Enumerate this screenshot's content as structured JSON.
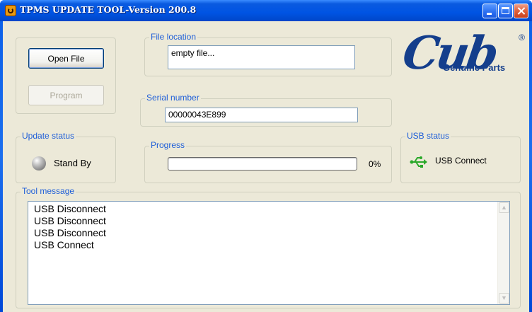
{
  "window": {
    "title": "TPMS UPDATE TOOL-Version 200.8"
  },
  "actions": {
    "open_file_label": "Open File",
    "program_label": "Program"
  },
  "file_location": {
    "label": "File location",
    "value": "empty file..."
  },
  "serial_number": {
    "label": "Serial number",
    "value": "00000043E899"
  },
  "logo": {
    "mark": "Cub",
    "registered": "®",
    "tagline": "Genuine Parts"
  },
  "update_status": {
    "label": "Update status",
    "value": "Stand By"
  },
  "progress": {
    "label": "Progress",
    "percent_text": "0%",
    "fraction": 0
  },
  "usb_status": {
    "label": "USB status",
    "value": "USB Connect"
  },
  "tool_message": {
    "label": "Tool message",
    "lines": [
      "USB Disconnect",
      "USB Disconnect",
      "USB Disconnect",
      "USB Connect"
    ]
  },
  "icons": {
    "app": "app-icon",
    "status": "status-led-icon",
    "usb": "usb-icon"
  },
  "colors": {
    "group_label": "#1f5fd8",
    "logo": "#143e8c",
    "usb_icon": "#2aa82a"
  }
}
